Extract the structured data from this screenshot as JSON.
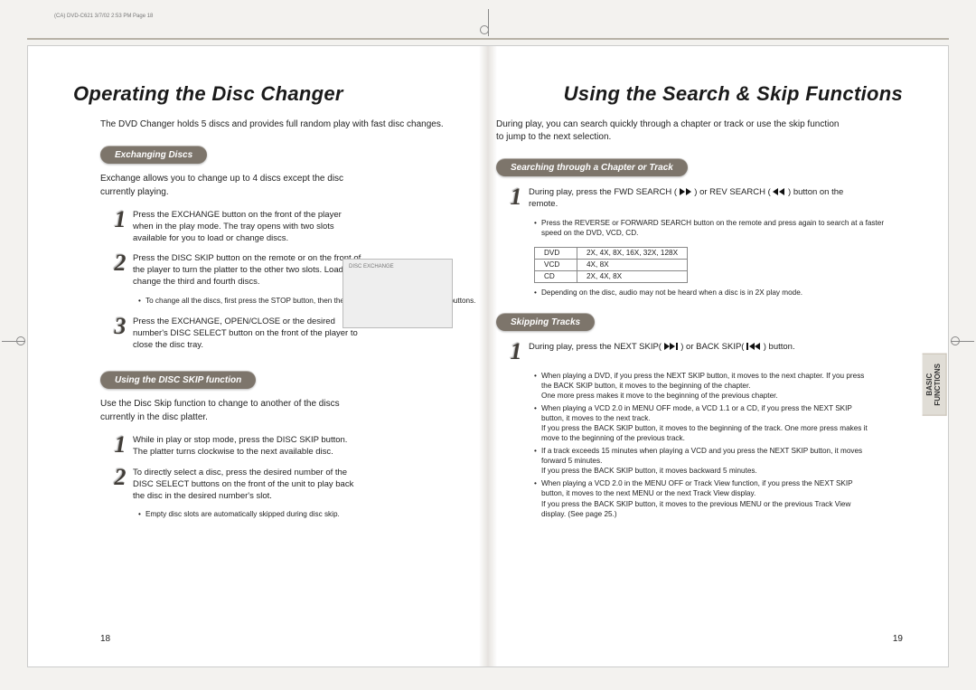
{
  "meta": {
    "printLine": "(CA) DVD-C621  3/7/02 2:53 PM  Page 18"
  },
  "left": {
    "title": "Operating the Disc Changer",
    "intro": "The DVD Changer holds 5 discs and provides full random play with fast disc changes.",
    "sectionA": {
      "heading": "Exchanging Discs",
      "intro": "Exchange allows you to change up to 4 discs except the disc currently playing.",
      "steps": [
        "Press the EXCHANGE button on the front of the player when in the play mode. The tray opens with two slots available for you to load or change discs.",
        "Press the DISC SKIP button on the remote or on the front of the player to turn the platter to the other two slots. Load or change the third and fourth discs.",
        "Press the EXCHANGE, OPEN/CLOSE or the desired number's DISC SELECT button on the front of the player to close the disc tray."
      ],
      "bullets": [
        "To change all the discs, first press the STOP button, then the OPEN/CLOSE and DISC SKIP buttons."
      ],
      "imageLabel": "DISC EXCHANGE"
    },
    "sectionB": {
      "heading": "Using the DISC SKIP function",
      "intro": "Use the Disc Skip function to change to another of the discs currently in the disc platter.",
      "steps": [
        "While in play or stop mode, press the DISC SKIP button. The platter turns clockwise to the next available disc.",
        "To directly select a disc, press the desired number of the DISC SELECT buttons on the front of the unit to play back the disc in the desired number's slot."
      ],
      "bullets": [
        "Empty disc slots are automatically skipped during disc skip."
      ]
    },
    "pageNum": "18"
  },
  "right": {
    "title": "Using the Search & Skip Functions",
    "intro": "During play, you can search quickly through a chapter or track or use the skip function to jump to the next selection.",
    "sectionA": {
      "heading": "Searching through a Chapter or Track",
      "step1_a": "During play, press the FWD SEARCH (",
      "step1_b": ") or REV SEARCH (",
      "step1_c": ") button on the remote.",
      "bullets": [
        "Press the REVERSE or FORWARD SEARCH button on the remote and press again to search at a faster speed on the DVD, VCD, CD."
      ],
      "table": {
        "rows": [
          [
            "DVD",
            "2X, 4X, 8X, 16X, 32X, 128X"
          ],
          [
            "VCD",
            "4X, 8X"
          ],
          [
            "CD",
            "2X, 4X, 8X"
          ]
        ]
      },
      "footnote": "Depending on the disc, audio may not be heard when a disc is in 2X play mode."
    },
    "sectionB": {
      "heading": "Skipping Tracks",
      "step1_a": "During play, press the NEXT SKIP(",
      "step1_b": ") or BACK SKIP(",
      "step1_c": ") button.",
      "bullets": [
        "When playing a DVD, if you press the NEXT SKIP button, it moves to the next chapter. If you press the BACK SKIP button, it moves to the beginning of the chapter.\nOne more press makes it move to the beginning of the previous chapter.",
        "When playing a VCD 2.0 in MENU OFF mode, a VCD 1.1 or a CD, if you press the NEXT SKIP button, it moves to the next track.\nIf you press the BACK SKIP button, it moves to the beginning of the track. One more press makes it move to the beginning of the previous track.",
        "If a track exceeds 15 minutes when playing a VCD and you press the NEXT SKIP button, it moves forward 5 minutes.\nIf you press the BACK SKIP button, it moves backward 5 minutes.",
        "When playing a VCD 2.0 in the MENU OFF or Track View function, if you press the NEXT SKIP button, it moves to the next MENU or the next Track View display.\nIf you press the BACK SKIP button, it moves to the previous MENU or the previous Track View display. (See page 25.)"
      ]
    },
    "pageNum": "19",
    "tab": "BASIC\nFUNCTIONS"
  }
}
